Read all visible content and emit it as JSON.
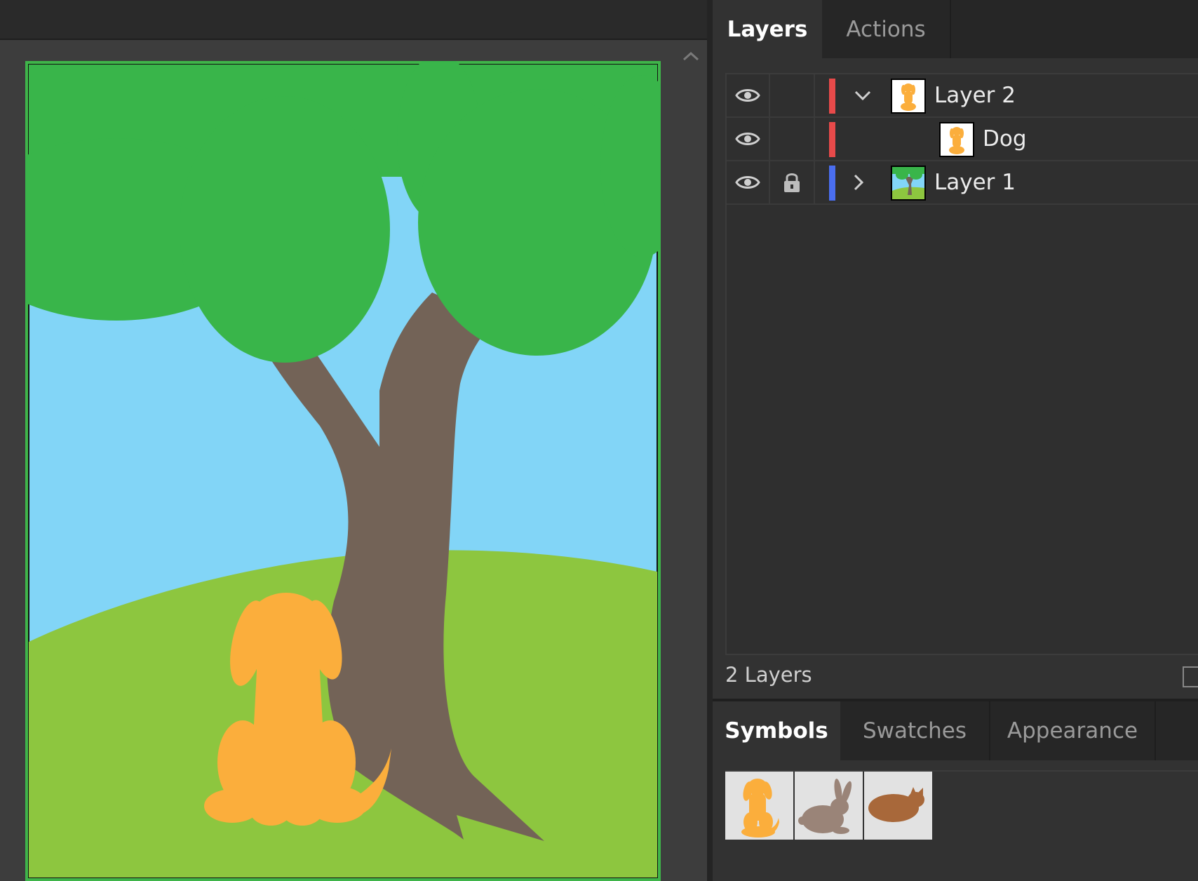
{
  "layers_panel": {
    "tabs": [
      {
        "label": "Layers",
        "active": true
      },
      {
        "label": "Actions",
        "active": false
      }
    ],
    "rows": [
      {
        "name": "Layer 2",
        "visible": true,
        "locked": false,
        "color": "#e84a4a",
        "expanded": true,
        "indent": 0
      },
      {
        "name": "Dog",
        "visible": true,
        "locked": false,
        "color": "#e84a4a",
        "indent": 1
      },
      {
        "name": "Layer 1",
        "visible": true,
        "locked": true,
        "color": "#4a6ef0",
        "expanded": false,
        "indent": 0
      }
    ],
    "count_label": "2 Layers"
  },
  "bottom_panel": {
    "tabs": [
      {
        "label": "Symbols",
        "active": true
      },
      {
        "label": "Swatches",
        "active": false
      },
      {
        "label": "Appearance",
        "active": false
      }
    ],
    "symbols": [
      {
        "name": "dog-symbol-icon",
        "color": "#fbae3c"
      },
      {
        "name": "rabbit-symbol-icon",
        "color": "#9a8478"
      },
      {
        "name": "cat-symbol-icon",
        "color": "#a8683a"
      }
    ]
  },
  "artwork": {
    "colors": {
      "sky": "#82d5f7",
      "foliage": "#39b54a",
      "trunk": "#736357",
      "grass": "#8dc63f",
      "dog": "#fbae3c",
      "artboard_border": "#3fb54a"
    }
  }
}
